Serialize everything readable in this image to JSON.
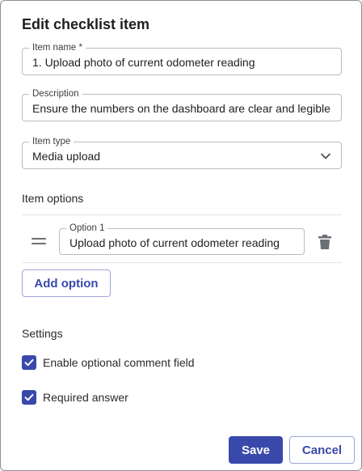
{
  "dialog": {
    "title": "Edit checklist item"
  },
  "fields": {
    "item_name": {
      "label": "Item name *",
      "value": "1. Upload photo of current odometer reading"
    },
    "description": {
      "label": "Description",
      "value": "Ensure the numbers on the dashboard are clear and legible i"
    },
    "item_type": {
      "label": "Item type",
      "value": "Media upload"
    }
  },
  "item_options": {
    "heading": "Item options",
    "options": [
      {
        "label": "Option 1",
        "value": "Upload photo of current odometer reading"
      }
    ],
    "add_label": "Add option"
  },
  "settings": {
    "heading": "Settings",
    "items": [
      {
        "label": "Enable optional comment field",
        "checked": true
      },
      {
        "label": "Required answer",
        "checked": true
      }
    ]
  },
  "actions": {
    "save_label": "Save",
    "cancel_label": "Cancel"
  },
  "colors": {
    "accent": "#3949ab",
    "border": "#b9bcc2",
    "divider": "#e4e6ea"
  },
  "icons": {
    "drag": "drag-handle-icon",
    "delete": "trash-icon",
    "dropdown": "chevron-down-icon",
    "check": "checkmark-icon"
  }
}
